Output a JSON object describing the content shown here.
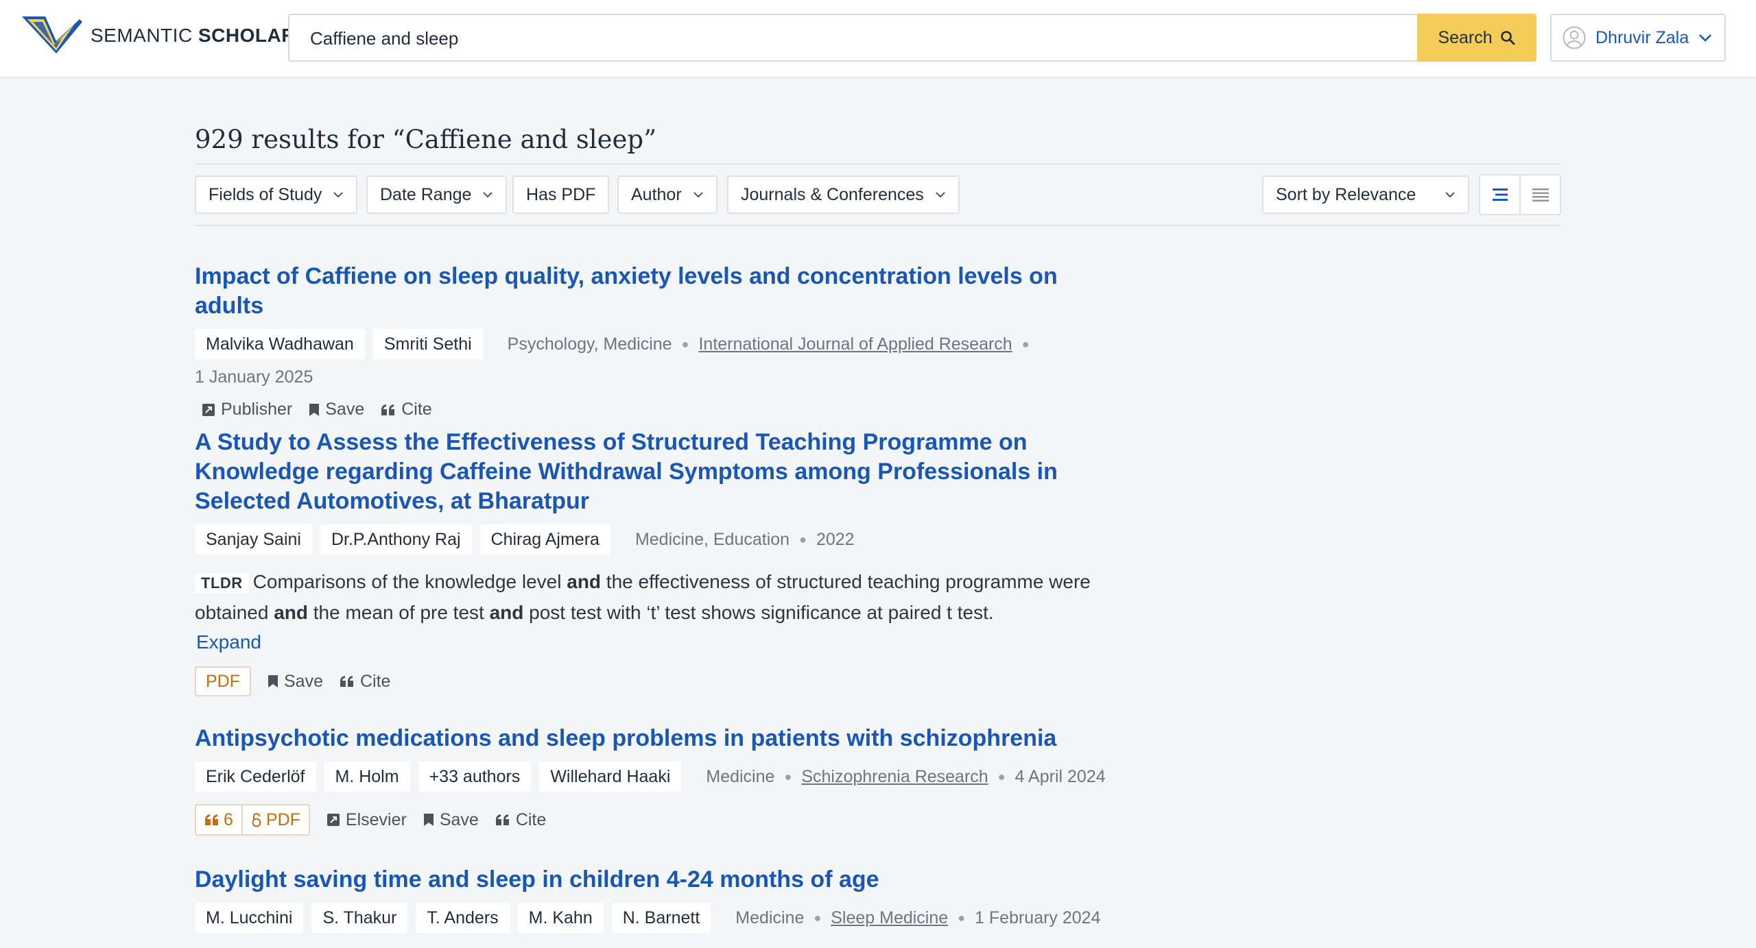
{
  "header": {
    "brand_light": "SEMANTIC",
    "brand_bold": "SCHOLAR",
    "search_value": "Caffiene and sleep",
    "search_button": "Search",
    "user_name": "Dhruvir Zala"
  },
  "results": {
    "title": "929 results for “Caffiene and sleep”"
  },
  "filters": {
    "fields_of_study": "Fields of Study",
    "date_range": "Date Range",
    "has_pdf": "Has PDF",
    "author": "Author",
    "journals": "Journals & Conferences",
    "sort": "Sort by Relevance"
  },
  "papers": [
    {
      "title": "Impact of Caffiene on sleep quality, anxiety levels and concentration levels on adults",
      "authors": [
        "Malvika Wadhawan",
        "Smriti Sethi"
      ],
      "fields": "Psychology, Medicine",
      "venue": "International Journal of Applied Research",
      "date": "1 January 2025",
      "actions": {
        "publisher": "Publisher",
        "save": "Save",
        "cite": "Cite"
      }
    },
    {
      "title": "A Study to Assess the Effectiveness of Structured Teaching Programme on Knowledge regarding Caffeine Withdrawal Symptoms among Professionals in Selected Automotives, at Bharatpur",
      "authors": [
        "Sanjay Saini",
        "Dr.P.Anthony Raj",
        "Chirag Ajmera"
      ],
      "fields": "Medicine, Education",
      "date": "2022",
      "tldr_label": "TLDR",
      "tldr": {
        "p1": "Comparisons of the knowledge level ",
        "b1": "and",
        "p2": " the effectiveness of structured teaching programme were obtained ",
        "b2": "and",
        "p3": " the mean of pre test ",
        "b3": "and",
        "p4": " post test with ‘t’ test shows significance at paired t test."
      },
      "expand": "Expand",
      "actions": {
        "pdf": "PDF",
        "save": "Save",
        "cite": "Cite"
      }
    },
    {
      "title": "Antipsychotic medications and sleep problems in patients with schizophrenia",
      "authors": [
        "Erik Cederlöf",
        "M. Holm",
        "+33 authors",
        "Willehard Haaki"
      ],
      "fields": "Medicine",
      "venue": "Schizophrenia Research",
      "date": "4 April 2024",
      "actions": {
        "citations": "6",
        "pdf": "PDF",
        "publisher": "Elsevier",
        "save": "Save",
        "cite": "Cite"
      }
    },
    {
      "title": "Daylight saving time and sleep in children 4-24 months of age",
      "authors": [
        "M. Lucchini",
        "S. Thakur",
        "T. Anders",
        "M. Kahn",
        "N. Barnett"
      ],
      "fields": "Medicine",
      "venue": "Sleep Medicine",
      "date": "1 February 2024"
    }
  ],
  "colors": {
    "link_blue": "#1857b6",
    "search_yellow": "#f3cd57",
    "pdf_orange": "#c06f12",
    "page_bg": "#f4f5f7"
  },
  "icons": [
    "semantic-scholar-logo",
    "search-icon",
    "user-avatar-icon",
    "chevron-down-icon",
    "list-view-icon",
    "compact-view-icon",
    "publisher-icon",
    "bookmark-icon",
    "quote-icon",
    "open-access-icon"
  ]
}
